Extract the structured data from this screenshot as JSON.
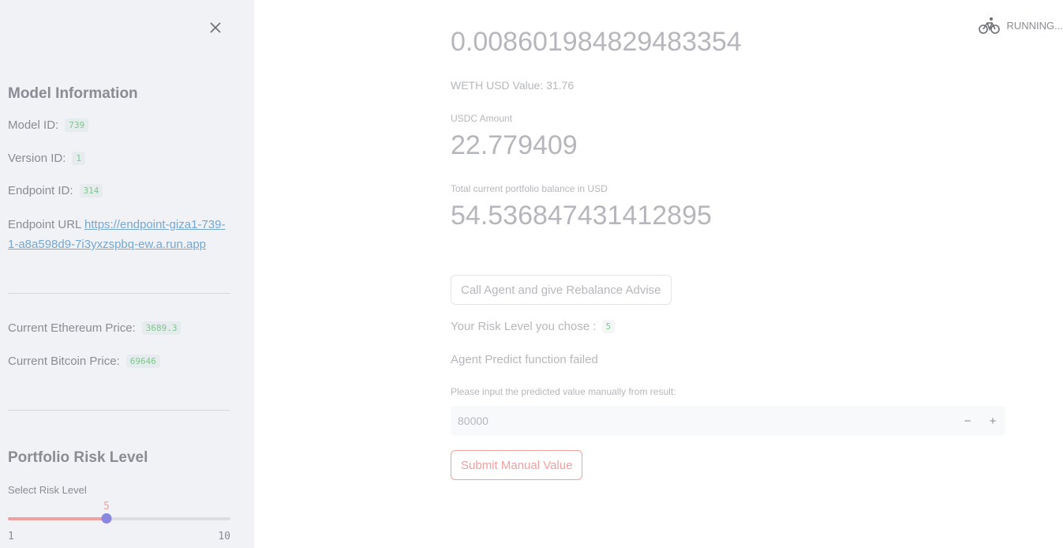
{
  "sidebar": {
    "model_info_heading": "Model Information",
    "model_id_label": "Model ID:",
    "model_id_value": "739",
    "version_id_label": "Version ID:",
    "version_id_value": "1",
    "endpoint_id_label": "Endpoint ID:",
    "endpoint_id_value": "314",
    "endpoint_url_label": "Endpoint URL",
    "endpoint_url_value": "https://endpoint-giza1-739-1-a8a598d9-7i3yxzspbq-ew.a.run.app",
    "eth_price_label": "Current Ethereum Price:",
    "eth_price_value": "3689.3",
    "btc_price_label": "Current Bitcoin Price:",
    "btc_price_value": "69646",
    "risk_heading": "Portfolio Risk Level",
    "risk_slider": {
      "label": "Select Risk Level",
      "value": 5,
      "value_text": "5",
      "min": 1,
      "max": 10,
      "min_text": "1",
      "max_text": "10"
    }
  },
  "status": {
    "text": "RUNNING...",
    "icon": "bicycle-icon"
  },
  "main": {
    "weth_amount_partial": "0.008601984829483354",
    "weth_usd_text": "WETH USD Value: 31.76",
    "usdc_label": "USDC Amount",
    "usdc_value": "22.779409",
    "total_label": "Total current portfolio balance in USD",
    "total_value": "54.536847431412895",
    "call_agent_button": "Call Agent and give Rebalance Advise",
    "risk_chosen_label": "Your Risk Level you chose :",
    "risk_chosen_value": "5",
    "predict_failed_text": "Agent Predict function failed",
    "manual_input_label": "Please input the predicted value manually from result:",
    "manual_input_value": "80000",
    "stepper_minus": "−",
    "stepper_plus": "+",
    "submit_button": "Submit Manual Value"
  },
  "colors": {
    "sidebar_bg": "#f0f2f6",
    "accent": "#ff4b4b",
    "slider_thumb": "#6c63e0",
    "code_text": "#21a33b",
    "link": "#1f77b4"
  }
}
